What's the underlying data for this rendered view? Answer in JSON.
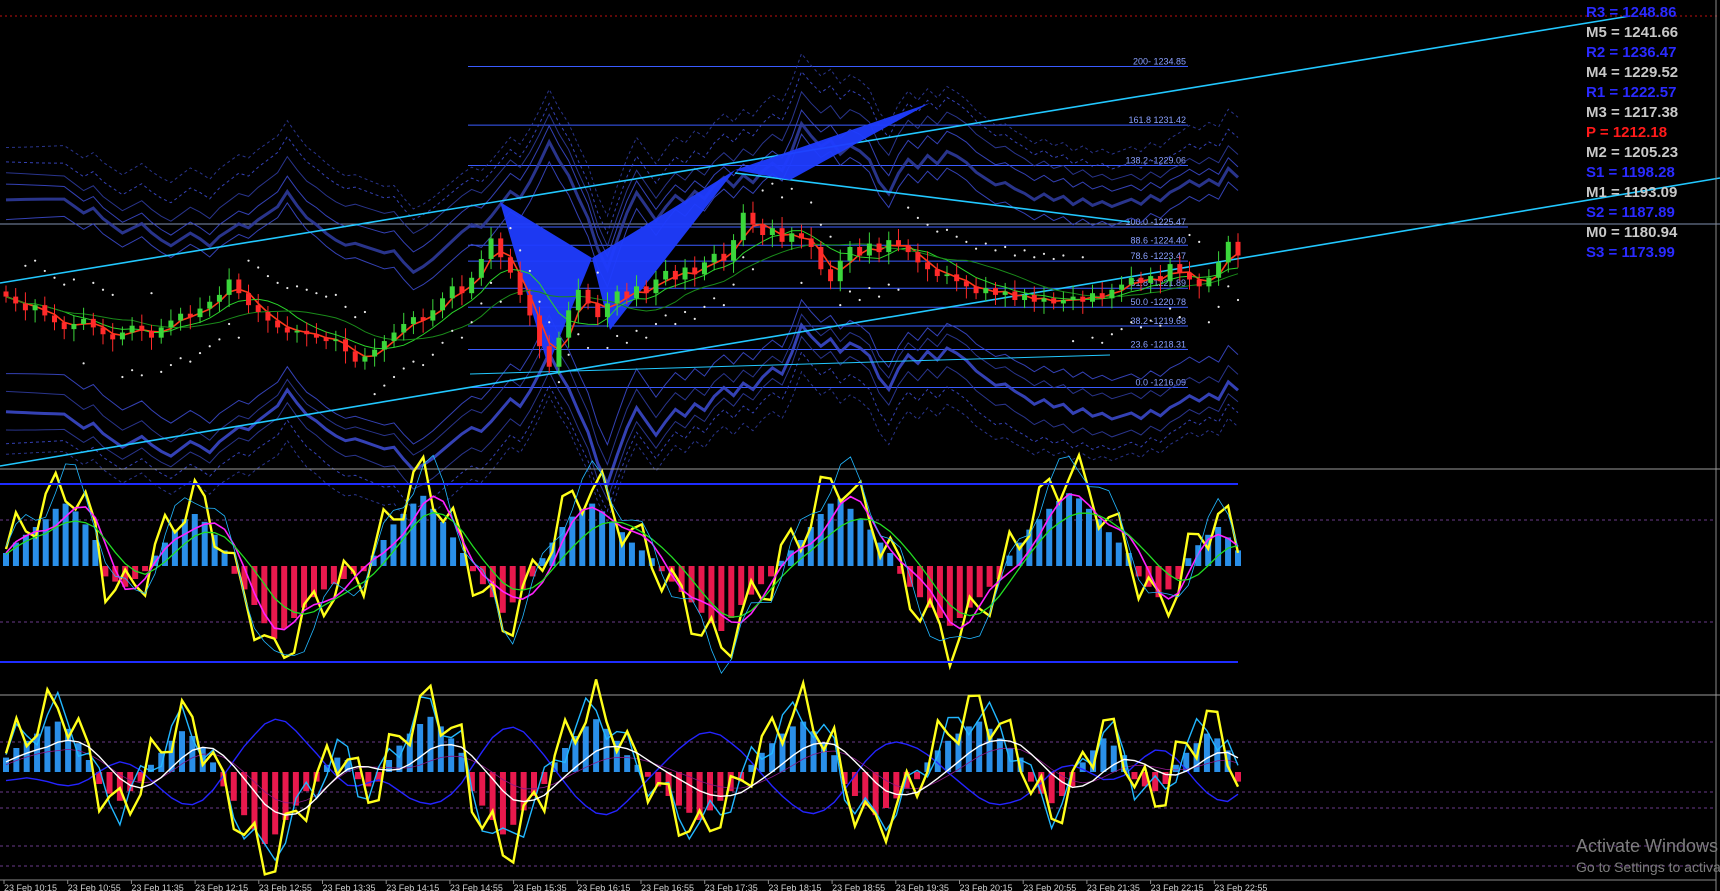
{
  "chart_data": [
    {
      "type": "line",
      "panel": "price",
      "description_of_marks": "candlestick price pane",
      "pivot_levels": [
        {
          "label": "R3 = 1248.86",
          "value": 1248.86,
          "color": "#2a2aff"
        },
        {
          "label": "M5 = 1241.66",
          "value": 1241.66,
          "color": "#c8c8c8"
        },
        {
          "label": "R2 = 1236.47",
          "value": 1236.47,
          "color": "#2a2aff"
        },
        {
          "label": "M4 = 1229.52",
          "value": 1229.52,
          "color": "#c8c8c8"
        },
        {
          "label": "R1 = 1222.57",
          "value": 1222.57,
          "color": "#2a2aff"
        },
        {
          "label": "M3 = 1217.38",
          "value": 1217.38,
          "color": "#c8c8c8"
        },
        {
          "label": "P  = 1212.18",
          "value": 1212.18,
          "color": "#ff1a1a"
        },
        {
          "label": "M2 = 1205.23",
          "value": 1205.23,
          "color": "#c8c8c8"
        },
        {
          "label": "S1 = 1198.28",
          "value": 1198.28,
          "color": "#2a2aff"
        },
        {
          "label": "M1 = 1193.09",
          "value": 1193.09,
          "color": "#c8c8c8"
        },
        {
          "label": "S2 = 1187.89",
          "value": 1187.89,
          "color": "#2a2aff"
        },
        {
          "label": "M0 = 1180.94",
          "value": 1180.94,
          "color": "#c8c8c8"
        },
        {
          "label": "S3 = 1173.99",
          "value": 1173.99,
          "color": "#2a2aff"
        }
      ],
      "fib_levels": [
        {
          "label": "200- 1234.85",
          "value": 1234.85
        },
        {
          "label": "161.8 1231.42",
          "value": 1231.42
        },
        {
          "label": "138.2 -1229.06",
          "value": 1229.06
        },
        {
          "label": "100.0 -1225.47",
          "value": 1225.47
        },
        {
          "label": "88.6 -1224.40",
          "value": 1224.4
        },
        {
          "label": "78.6 -1223.47",
          "value": 1223.47
        },
        {
          "label": "61.8 -1221.89",
          "value": 1221.89
        },
        {
          "label": "50.0 -1220.78",
          "value": 1220.78
        },
        {
          "label": "38.2 -1219.68",
          "value": 1219.68
        },
        {
          "label": "23.6 -1218.31",
          "value": 1218.31
        },
        {
          "label": "0.0 -1216.09",
          "value": 1216.09
        }
      ],
      "ylim": [
        1211.5,
        1238.5
      ],
      "close": [
        1221.4,
        1221.0,
        1220.6,
        1220.9,
        1220.3,
        1219.9,
        1219.5,
        1219.8,
        1220.1,
        1219.6,
        1219.2,
        1218.9,
        1219.3,
        1219.7,
        1219.4,
        1219.0,
        1219.6,
        1220.0,
        1220.4,
        1220.2,
        1220.7,
        1221.1,
        1221.5,
        1222.4,
        1221.6,
        1220.9,
        1220.5,
        1220.0,
        1219.6,
        1219.3,
        1219.4,
        1219.2,
        1219.0,
        1218.8,
        1218.9,
        1218.2,
        1217.6,
        1217.9,
        1218.3,
        1218.8,
        1219.3,
        1219.8,
        1220.2,
        1220.0,
        1220.6,
        1221.3,
        1222.0,
        1221.6,
        1222.5,
        1223.6,
        1224.8,
        1223.7,
        1222.8,
        1221.5,
        1220.3,
        1218.5,
        1217.3,
        1219.0,
        1220.6,
        1221.8,
        1221.0,
        1220.2,
        1221.0,
        1221.7,
        1221.3,
        1222.0,
        1221.6,
        1222.4,
        1222.9,
        1222.4,
        1223.1,
        1222.7,
        1223.4,
        1223.9,
        1223.5,
        1224.7,
        1226.3,
        1225.6,
        1225.0,
        1225.4,
        1224.6,
        1225.1,
        1224.8,
        1224.3,
        1223.0,
        1222.3,
        1223.5,
        1224.3,
        1223.8,
        1224.5,
        1224.0,
        1224.7,
        1224.4,
        1224.0,
        1223.4,
        1223.0,
        1222.6,
        1222.7,
        1222.3,
        1222.0,
        1221.6,
        1221.9,
        1221.5,
        1221.7,
        1221.2,
        1221.5,
        1221.1,
        1221.3,
        1221.0,
        1221.2,
        1221.4,
        1221.1,
        1221.6,
        1221.3,
        1221.8,
        1222.1,
        1222.5,
        1222.2,
        1222.6,
        1222.3,
        1223.3,
        1222.8,
        1222.4,
        1222.0,
        1222.5,
        1223.4,
        1224.6,
        1223.8
      ],
      "x_ticks": [
        "23 Feb 10:15",
        "23 Feb 10:55",
        "23 Feb 11:35",
        "23 Feb 12:15",
        "23 Feb 12:55",
        "23 Feb 13:35",
        "23 Feb 14:15",
        "23 Feb 14:55",
        "23 Feb 15:35",
        "23 Feb 16:15",
        "23 Feb 16:55",
        "23 Feb 17:35",
        "23 Feb 18:15",
        "23 Feb 18:55",
        "23 Feb 19:35",
        "23 Feb 20:15",
        "23 Feb 20:55",
        "23 Feb 21:35",
        "23 Feb 22:15",
        "23 Feb 22:55"
      ],
      "colors": {
        "up": "#3bd63b",
        "down": "#ff2a2a",
        "channel": "#22c8ff",
        "harmonic": "#1f3cff",
        "fib": "#3a5cff"
      }
    },
    {
      "type": "bar",
      "panel": "oscillator-1",
      "histogram": [
        5,
        9,
        12,
        15,
        18,
        22,
        24,
        21,
        16,
        10,
        -4,
        -6,
        -8,
        -5,
        -2,
        4,
        9,
        14,
        18,
        20,
        17,
        12,
        6,
        -3,
        -9,
        -15,
        -22,
        -28,
        -24,
        -20,
        -16,
        -12,
        -9,
        -7,
        -5,
        -3,
        -2,
        4,
        10,
        16,
        20,
        24,
        27,
        22,
        17,
        11,
        5,
        -2,
        -7,
        -12,
        -18,
        -14,
        -9,
        -4,
        3,
        9,
        15,
        19,
        22,
        24,
        21,
        17,
        13,
        9,
        6,
        3,
        -2,
        -6,
        -10,
        -14,
        -18,
        -22,
        -25,
        -20,
        -15,
        -11,
        -7,
        -4,
        2,
        6,
        10,
        15,
        20,
        24,
        26,
        22,
        18,
        14,
        9,
        5,
        -3,
        -8,
        -12,
        -16,
        -20,
        -23,
        -20,
        -16,
        -12,
        -8,
        -5,
        4,
        9,
        14,
        18,
        22,
        25,
        28,
        26,
        22,
        18,
        13,
        9,
        5,
        -4,
        -8,
        -12,
        -9,
        -5,
        3,
        8,
        12,
        15,
        11,
        6
      ],
      "colors": {
        "pos": "#2a8fe8",
        "neg": "#e8194d",
        "fast": "#ffff1a",
        "signal": "#ff22ff",
        "slow": "#22dd22",
        "thin": "#22b7ff",
        "band": "#1e2cff"
      }
    },
    {
      "type": "bar",
      "panel": "oscillator-2",
      "histogram": [
        6,
        10,
        13,
        16,
        19,
        21,
        18,
        12,
        5,
        -5,
        -9,
        -12,
        -8,
        -4,
        3,
        8,
        13,
        17,
        15,
        10,
        4,
        -6,
        -12,
        -18,
        -24,
        -30,
        -26,
        -20,
        -14,
        -8,
        -4,
        3,
        6,
        5,
        -3,
        -6,
        -4,
        5,
        11,
        16,
        20,
        23,
        19,
        14,
        8,
        -8,
        -14,
        -20,
        -26,
        -22,
        -16,
        -10,
        -5,
        4,
        10,
        15,
        19,
        22,
        18,
        13,
        7,
        3,
        -2,
        -6,
        -10,
        -14,
        -17,
        -20,
        -16,
        -12,
        -8,
        -4,
        3,
        8,
        12,
        16,
        19,
        21,
        17,
        12,
        7,
        -5,
        -10,
        -14,
        -18,
        -15,
        -11,
        -7,
        -3,
        4,
        9,
        13,
        16,
        19,
        21,
        18,
        14,
        10,
        6,
        -4,
        -9,
        -13,
        -10,
        -6,
        4,
        9,
        14,
        11,
        7,
        -3,
        -6,
        -8,
        -5,
        3,
        8,
        12,
        16,
        14,
        9,
        -4
      ],
      "colors": {
        "pos": "#2a8fe8",
        "neg": "#e8194d",
        "fast": "#ffff1a",
        "white": "#ffffff",
        "blue": "#2424ff",
        "cyan": "#22b7ff"
      }
    }
  ],
  "watermark": {
    "line1": "Activate Windows",
    "line2": "Go to Settings to activate Windows."
  }
}
